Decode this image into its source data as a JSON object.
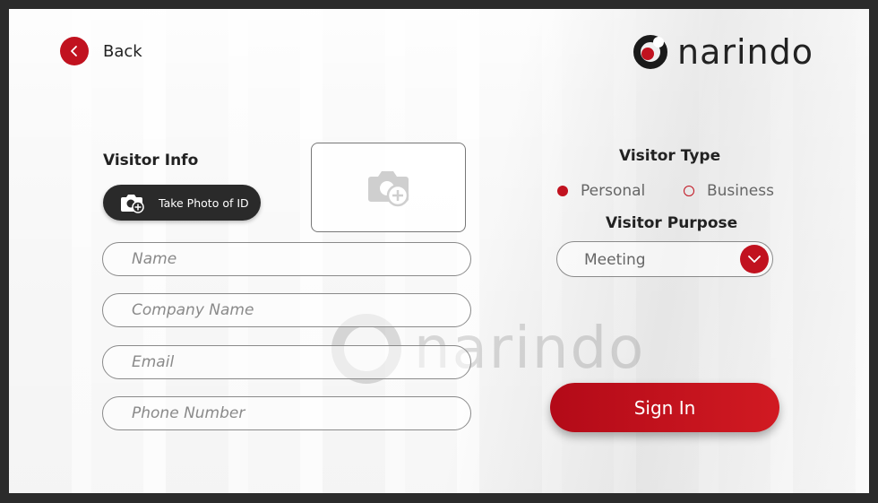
{
  "nav": {
    "back_label": "Back"
  },
  "brand": {
    "logo_text": "narindo",
    "accent": "#c1121f"
  },
  "visitor_info": {
    "title": "Visitor Info",
    "photo_button_label": "Take Photo of ID",
    "fields": {
      "name": {
        "placeholder": "Name",
        "value": ""
      },
      "company": {
        "placeholder": "Company Name",
        "value": ""
      },
      "email": {
        "placeholder": "Email",
        "value": ""
      },
      "phone": {
        "placeholder": "Phone Number",
        "value": ""
      }
    }
  },
  "visitor_type": {
    "title": "Visitor Type",
    "options": [
      {
        "label": "Personal",
        "selected": true
      },
      {
        "label": "Business",
        "selected": false
      }
    ]
  },
  "visitor_purpose": {
    "title": "Visitor Purpose",
    "selected": "Meeting"
  },
  "actions": {
    "sign_in_label": "Sign In"
  },
  "icons": {
    "back": "chevron-left-icon",
    "camera": "camera-add-icon",
    "dropdown": "chevron-down-icon"
  }
}
